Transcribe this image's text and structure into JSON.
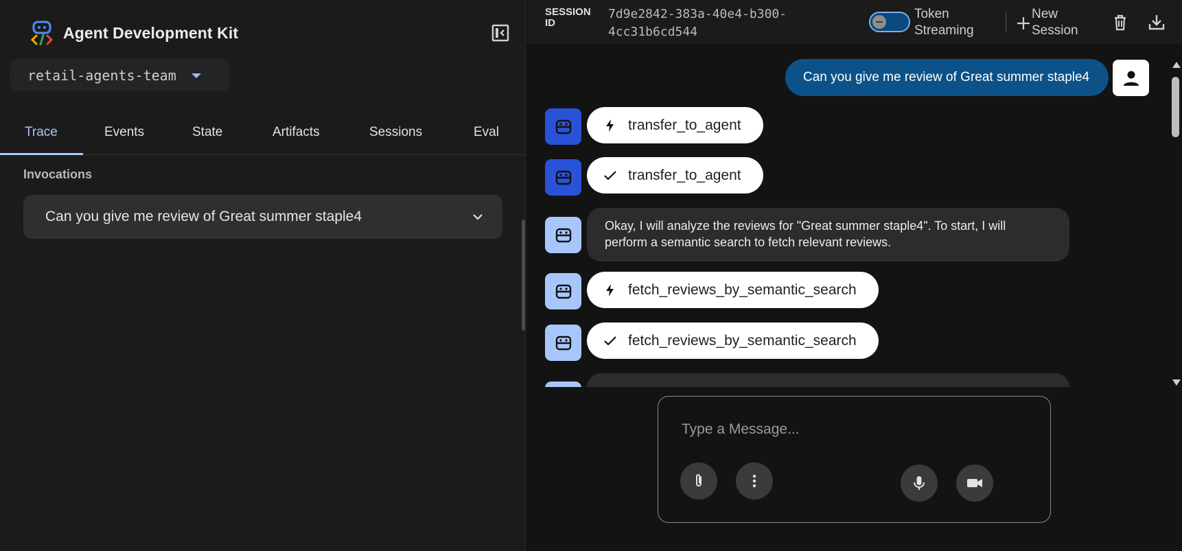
{
  "app": {
    "title": "Agent Development Kit"
  },
  "agent_selector": {
    "value": "retail-agents-team"
  },
  "tabs": [
    {
      "label": "Trace"
    },
    {
      "label": "Events"
    },
    {
      "label": "State"
    },
    {
      "label": "Artifacts"
    },
    {
      "label": "Sessions"
    },
    {
      "label": "Eval"
    }
  ],
  "invocations": {
    "label": "Invocations",
    "items": [
      {
        "text": "Can you give me review of Great summer staple4"
      }
    ]
  },
  "header": {
    "session_label": "SESSION ID",
    "session_id": "7d9e2842-383a-40e4-b300-4cc31b6cd544",
    "token_streaming_label": "Token Streaming",
    "new_session_label": "New Session"
  },
  "chat": {
    "user_message": "Can you give me review of Great summer staple4",
    "events": [
      {
        "kind": "function_call",
        "name": "transfer_to_agent"
      },
      {
        "kind": "function_response",
        "name": "transfer_to_agent"
      },
      {
        "kind": "text",
        "text": "Okay, I will analyze the reviews for \"Great summer staple4\". To start, I will perform a semantic search to fetch relevant reviews."
      },
      {
        "kind": "function_call",
        "name": "fetch_reviews_by_semantic_search"
      },
      {
        "kind": "function_response",
        "name": "fetch_reviews_by_semantic_search"
      }
    ]
  },
  "composer": {
    "placeholder": "Type a Message..."
  },
  "colors": {
    "accent": "#a8c7fa",
    "user_bubble": "#0c5288",
    "agent_avatar_primary": "#2a52d8",
    "agent_avatar_secondary": "#a7c6fb"
  }
}
